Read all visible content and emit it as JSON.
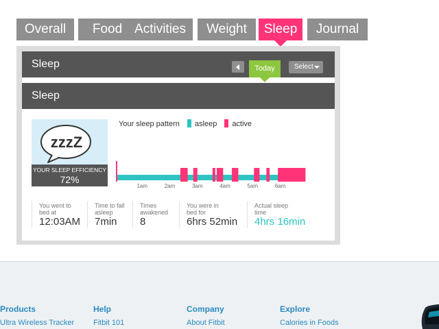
{
  "tabs": [
    {
      "label": "Overall",
      "active": false
    },
    {
      "label": "Food",
      "active": false
    },
    {
      "label": "Activities",
      "active": false
    },
    {
      "label": "Weight",
      "active": false
    },
    {
      "label": "Sleep",
      "active": true
    },
    {
      "label": "Journal",
      "active": false
    }
  ],
  "panel": {
    "header_title": "Sleep",
    "today_label": "Today",
    "select_label": "Select",
    "section_title": "Sleep"
  },
  "efficiency": {
    "bubble_text": "zzzZ",
    "caption": "YOUR SLEEP EFFICIENCY",
    "value": "72%"
  },
  "legend": {
    "title": "Your sleep pattern",
    "asleep_label": "asleep",
    "active_label": "active"
  },
  "chart_data": {
    "type": "bar",
    "x_ticks": [
      "1am",
      "2am",
      "3am",
      "4am",
      "5am",
      "6am"
    ],
    "series": [
      {
        "name": "asleep",
        "color": "#2ec4c4"
      },
      {
        "name": "active",
        "color": "#ff3478"
      }
    ],
    "range": [
      "0:03",
      "6:55"
    ],
    "active_periods": [
      [
        "0:03",
        "0:05"
      ],
      [
        "2:23",
        "2:39"
      ],
      [
        "2:51",
        "3:00"
      ],
      [
        "3:33",
        "3:39"
      ],
      [
        "3:42",
        "3:56"
      ],
      [
        "4:15",
        "4:29"
      ],
      [
        "5:03",
        "5:15"
      ],
      [
        "5:30",
        "5:37"
      ],
      [
        "5:55",
        "6:55"
      ]
    ]
  },
  "stats": [
    {
      "label": "You went to bed at",
      "value": "12:03AM",
      "highlight": false
    },
    {
      "label": "Time to fall asleep",
      "value": "7min",
      "highlight": false
    },
    {
      "label": "Times awakened",
      "value": "8",
      "highlight": false
    },
    {
      "label": "You were in bed for",
      "value": "6hrs 52min",
      "highlight": false
    },
    {
      "label": "Actual sleep time",
      "value": "4hrs 16min",
      "highlight": true
    }
  ],
  "footer": {
    "columns": [
      {
        "heading": "Products",
        "link": "Ultra Wireless Tracker"
      },
      {
        "heading": "Help",
        "link": "Fitbit 101"
      },
      {
        "heading": "Company",
        "link": "About Fitbit"
      },
      {
        "heading": "Explore",
        "link": "Calories in Foods"
      }
    ]
  },
  "colors": {
    "accent": "#ff3478",
    "asleep": "#2ec4c4",
    "today": "#8dc63f",
    "link": "#2a8cc0"
  }
}
